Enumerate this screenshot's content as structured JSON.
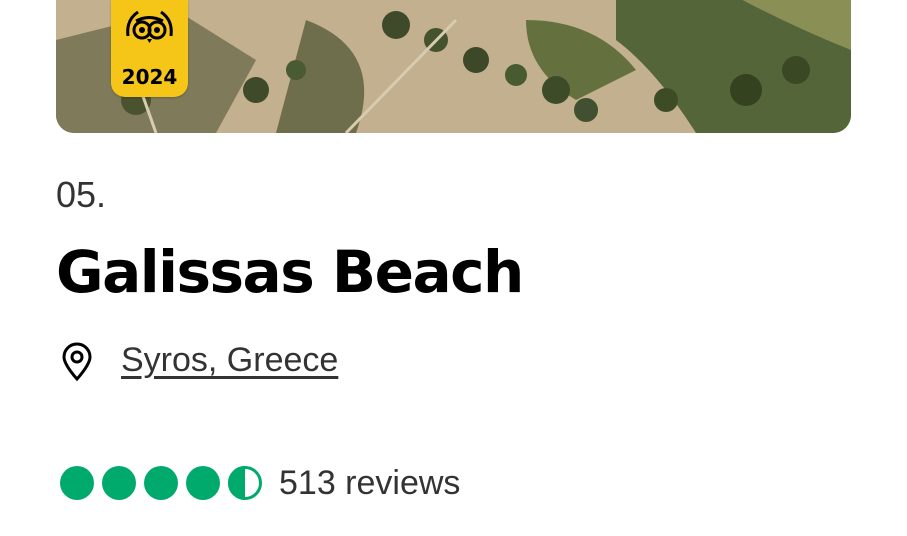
{
  "badge": {
    "year": "2024",
    "icon": "tripadvisor-owl-icon"
  },
  "listing": {
    "rank": "05.",
    "title": "Galissas Beach",
    "location": "Syros, Greece",
    "location_icon": "map-pin-icon",
    "rating": 4.5,
    "rating_max": 5,
    "reviews": "513 reviews"
  },
  "colors": {
    "rating_green": "#00aa6c",
    "badge_yellow": "#f5c518"
  }
}
